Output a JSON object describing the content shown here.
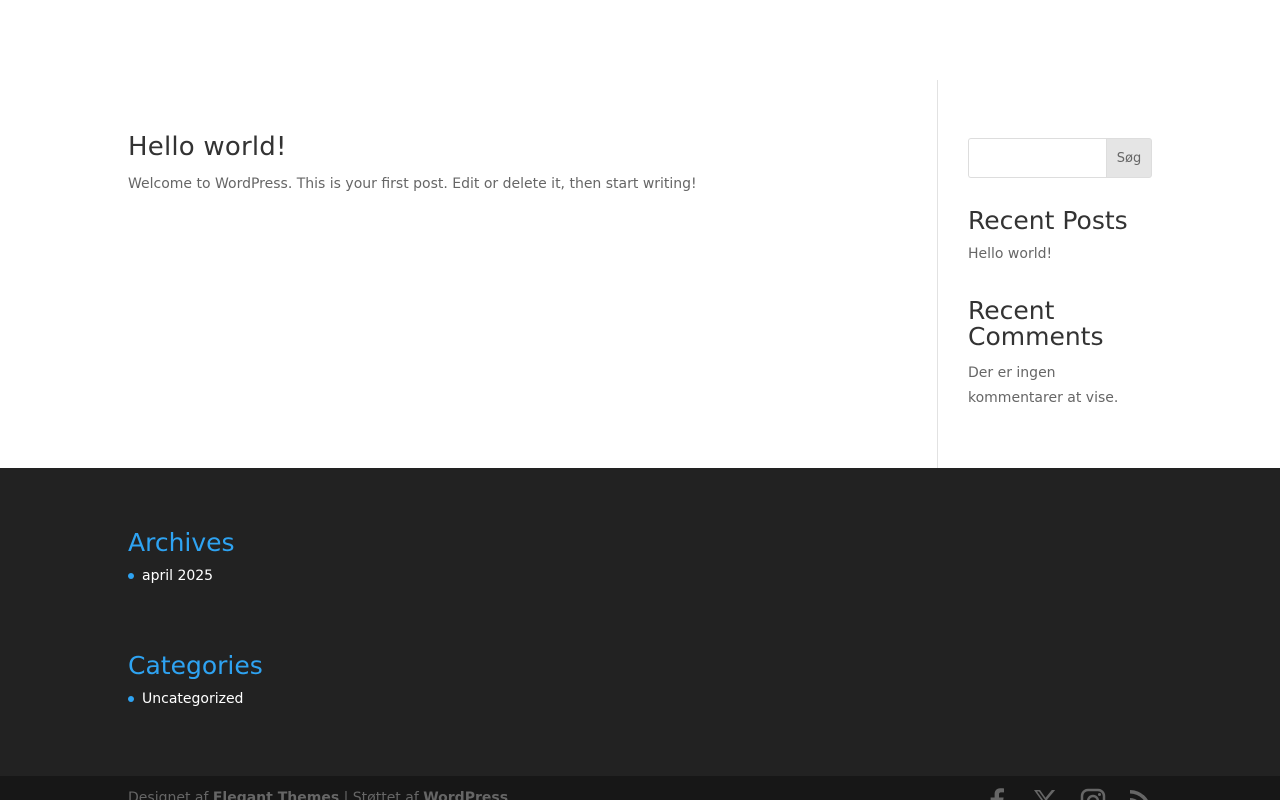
{
  "post": {
    "title": "Hello world!",
    "excerpt": "Welcome to WordPress. This is your first post. Edit or delete it, then start writing!"
  },
  "sidebar": {
    "search": {
      "placeholder": "",
      "button_label": "Søg"
    },
    "recent_posts": {
      "title": "Recent Posts",
      "items": [
        "Hello world!"
      ]
    },
    "recent_comments": {
      "title": "Recent Comments",
      "empty_text": "Der er ingen kommentarer at vise."
    }
  },
  "footer": {
    "archives": {
      "title": "Archives",
      "items": [
        "april 2025"
      ]
    },
    "categories": {
      "title": "Categories",
      "items": [
        "Uncategorized"
      ]
    },
    "credits": {
      "prefix": "Designet af",
      "theme_link": "Elegant Themes",
      "separator": " | Støttet af",
      "platform_link": "WordPress"
    },
    "social": [
      "facebook-icon",
      "x-icon",
      "instagram-icon",
      "rss-icon"
    ]
  },
  "colors": {
    "accent": "#2ea3f2",
    "footer_bg": "#222222",
    "bottom_bar_bg": "#171717",
    "text": "#666666",
    "heading": "#333333"
  }
}
